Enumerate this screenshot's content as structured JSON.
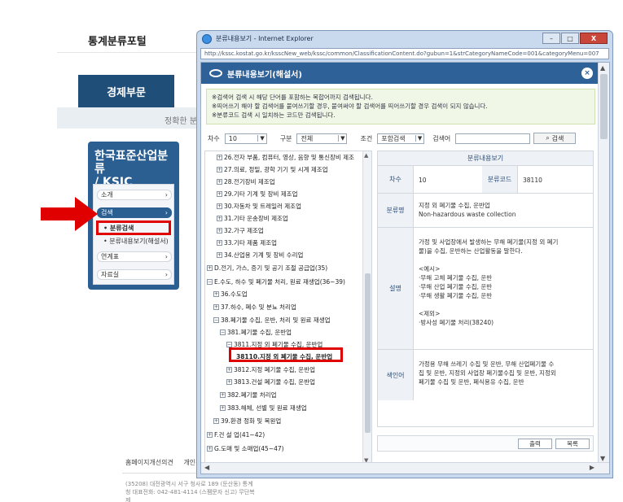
{
  "portal": {
    "title": "통계분류포털",
    "section_tab": "경제부문",
    "band_text": "정확한 분",
    "ksic_title_line1": "한국표준산업분류",
    "ksic_title_line2": "/ KSIC",
    "menu": [
      {
        "label": "소개",
        "chevron": "›"
      },
      {
        "label": "검색",
        "chevron": "›"
      },
      {
        "label": "연계표",
        "chevron": "›"
      },
      {
        "label": "자료실",
        "chevron": "›"
      }
    ],
    "submenu": [
      "분류검색",
      "분류내용보기(해설서)"
    ],
    "footer_links": [
      "홈페이지개선의견",
      "개인정보처리방"
    ],
    "footer_address": "(35208) 대전광역시 서구 청사로 189 (둔산동) 통계청  대표전화: 042-481-4114 (스팸문자 신고) 무단복제"
  },
  "browser": {
    "title": "분류내용보기 - Internet Explorer",
    "url": "http://kssc.kostat.go.kr/ksscNew_web/kssc/common/ClassificationContent.do?gubun=1&strCategoryNameCode=001&categoryMenu=007",
    "buttons": {
      "minimize": "–",
      "maximize": "□",
      "close": "X"
    }
  },
  "popup": {
    "title": "분류내용보기(해설서)",
    "close": "×",
    "notice": [
      "※검색어 검색 시 해당 단어를 포함하는 복합어까지 검색됩니다.",
      "※띄어쓰기 해야 할 검색어를 붙여쓰기할 경우, 붙여써야 할 검색어를 띄어쓰기할 경우 검색이 되지 않습니다.",
      "※분류코드 검색 시 일치하는 코드만 검색됩니다."
    ],
    "search": {
      "degree_label": "차수",
      "degree_value": "10",
      "category_label": "구분",
      "category_value": "전체",
      "condition_label": "조건",
      "condition_value": "포함검색",
      "keyword_label": "검색어",
      "keyword_value": "",
      "search_button": "검색",
      "caret": "▼"
    },
    "tree": [
      {
        "sign": "+",
        "text": "26.전자 부품, 컴퓨터, 영상, 음향 및 통신장비 제조"
      },
      {
        "sign": "+",
        "text": "27.의료, 정밀, 광학 기기 및 시계 제조업"
      },
      {
        "sign": "+",
        "text": "28.전기장비 제조업"
      },
      {
        "sign": "+",
        "text": "29.기타 기계 및 장비 제조업"
      },
      {
        "sign": "+",
        "text": "30.자동차 및 트레일러 제조업"
      },
      {
        "sign": "+",
        "text": "31.기타 운송장비 제조업"
      },
      {
        "sign": "+",
        "text": "32.가구 제조업"
      },
      {
        "sign": "+",
        "text": "33.기타 제품 제조업"
      },
      {
        "sign": "+",
        "text": "34.산업용 기계 및 장비 수리업"
      },
      {
        "sign": "+",
        "text": "D.전기, 가스, 증기 및 공기 조절 공급업(35)"
      },
      {
        "sign": "−",
        "text": "E.수도, 하수 및 폐기물 처리, 원료 재생업(36~39)"
      },
      {
        "sign": "+",
        "text": "36.수도업"
      },
      {
        "sign": "+",
        "text": "37.하수, 폐수 및 분뇨 처리업"
      },
      {
        "sign": "−",
        "text": "38.폐기물 수집, 운반, 처리 및 원료 재생업"
      },
      {
        "sign": "−",
        "text": "381.폐기물 수집, 운반업"
      },
      {
        "sign": "−",
        "text": "3811.지정 외 폐기물 수집, 운반업"
      },
      {
        "sign": "",
        "text": "38110.지정 외 폐기물 수집, 운반업"
      },
      {
        "sign": "+",
        "text": "3812.지정 폐기물 수집, 운반업"
      },
      {
        "sign": "+",
        "text": "3813.건설 폐기물 수집, 운반업"
      },
      {
        "sign": "+",
        "text": "382.폐기물 처리업"
      },
      {
        "sign": "+",
        "text": "383.해체, 선별 및 원료 재생업"
      },
      {
        "sign": "+",
        "text": "39.환경 정화 및 복원업"
      },
      {
        "sign": "+",
        "text": "F.건 설 업(41~42)"
      },
      {
        "sign": "+",
        "text": "G.도매 및 소매업(45~47)"
      }
    ],
    "detail": {
      "heading": "분류내용보기",
      "degree_label": "차수",
      "degree_value": "10",
      "code_label": "분류코드",
      "code_value": "38110",
      "name_label": "분류명",
      "name_ko": "지정 외 폐기물 수집, 운반업",
      "name_en": "Non-hazardous waste collection",
      "desc_label": "설명",
      "desc": [
        "가정 및 사업장에서 발생하는 무해 폐기물(지정 외 폐기",
        "물)을 수집, 운반하는 산업활동을 말한다.",
        "",
        "<예시>",
        "·무해 고체 폐기물 수집, 운반",
        "·무해 산업 폐기물 수집, 운반",
        "·무해 생활 폐기물 수집, 운반",
        "",
        "<제외>",
        "·방사성 폐기물 처리(38240)"
      ],
      "index_label": "색인어",
      "index": [
        "가정용 무해 쓰레기 수집 및 운반, 무해 산업폐기물 수",
        "집 및 운반, 지정외 사업장 폐기물수집 및 운반, 지정외",
        "폐기물 수집 및 운반, 폐식용유 수집, 운반"
      ]
    },
    "actions": {
      "print": "출력",
      "list": "목록"
    }
  },
  "colors": {
    "accent_red": "#e00000",
    "header_blue": "#2f6199",
    "portal_navy": "#1f4e79"
  }
}
